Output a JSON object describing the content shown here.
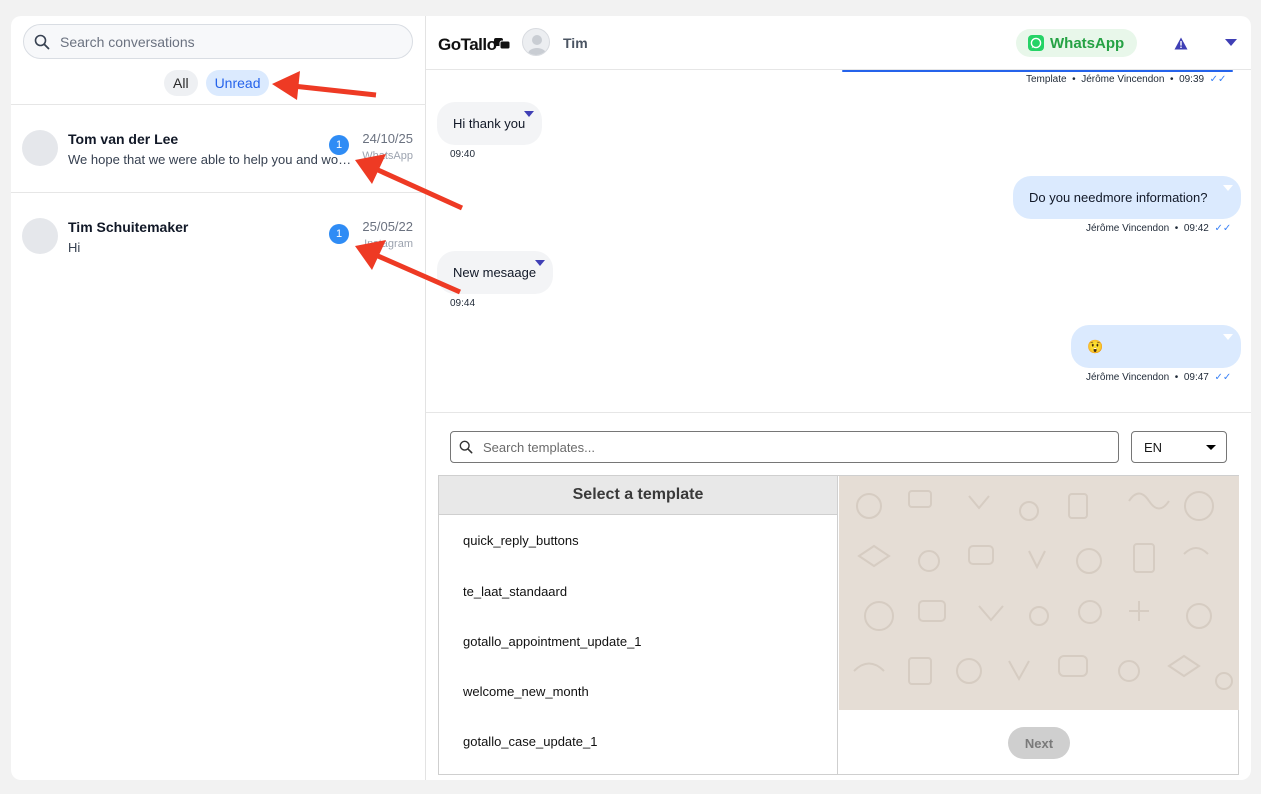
{
  "sidebar": {
    "search_placeholder": "Search conversations",
    "filters": {
      "all": "All",
      "unread": "Unread"
    },
    "conversations": [
      {
        "name": "Tom van der Lee",
        "preview": "We hope that we were able to help you and would love to hear your feedback",
        "date": "24/10/25",
        "channel": "WhatsApp",
        "unread": "1"
      },
      {
        "name": "Tim Schuitemaker",
        "preview": "Hi",
        "date": "25/05/22",
        "channel": "Instagram",
        "unread": "1"
      }
    ]
  },
  "header": {
    "logo": "GoTallo",
    "contact_name": "Tim",
    "channel_label": "WhatsApp",
    "channel_color": "#25a244"
  },
  "messages": [
    {
      "direction": "out",
      "meta_prefix": "Template",
      "sender": "Jérôme Vincendon",
      "time": "09:39"
    },
    {
      "direction": "in",
      "text": "Hi thank you",
      "time": "09:40"
    },
    {
      "direction": "out",
      "text": "Do you needmore information?",
      "sender": "Jérôme Vincendon",
      "time": "09:42"
    },
    {
      "direction": "in",
      "text": "New mesaage",
      "time": "09:44"
    },
    {
      "direction": "out",
      "text": "😲",
      "sender": "Jérôme Vincendon",
      "time": "09:47"
    }
  ],
  "meta_separator": "•",
  "read_tick": "✓✓",
  "templates": {
    "search_placeholder": "Search templates...",
    "language": "EN",
    "heading": "Select a template",
    "items": [
      "quick_reply_buttons",
      "te_laat_standaard",
      "gotallo_appointment_update_1",
      "welcome_new_month",
      "gotallo_case_update_1"
    ],
    "next_label": "Next"
  },
  "colors": {
    "accent": "#2563eb",
    "badge": "#2f8cf5",
    "annotation_arrow": "#ee3a24"
  }
}
